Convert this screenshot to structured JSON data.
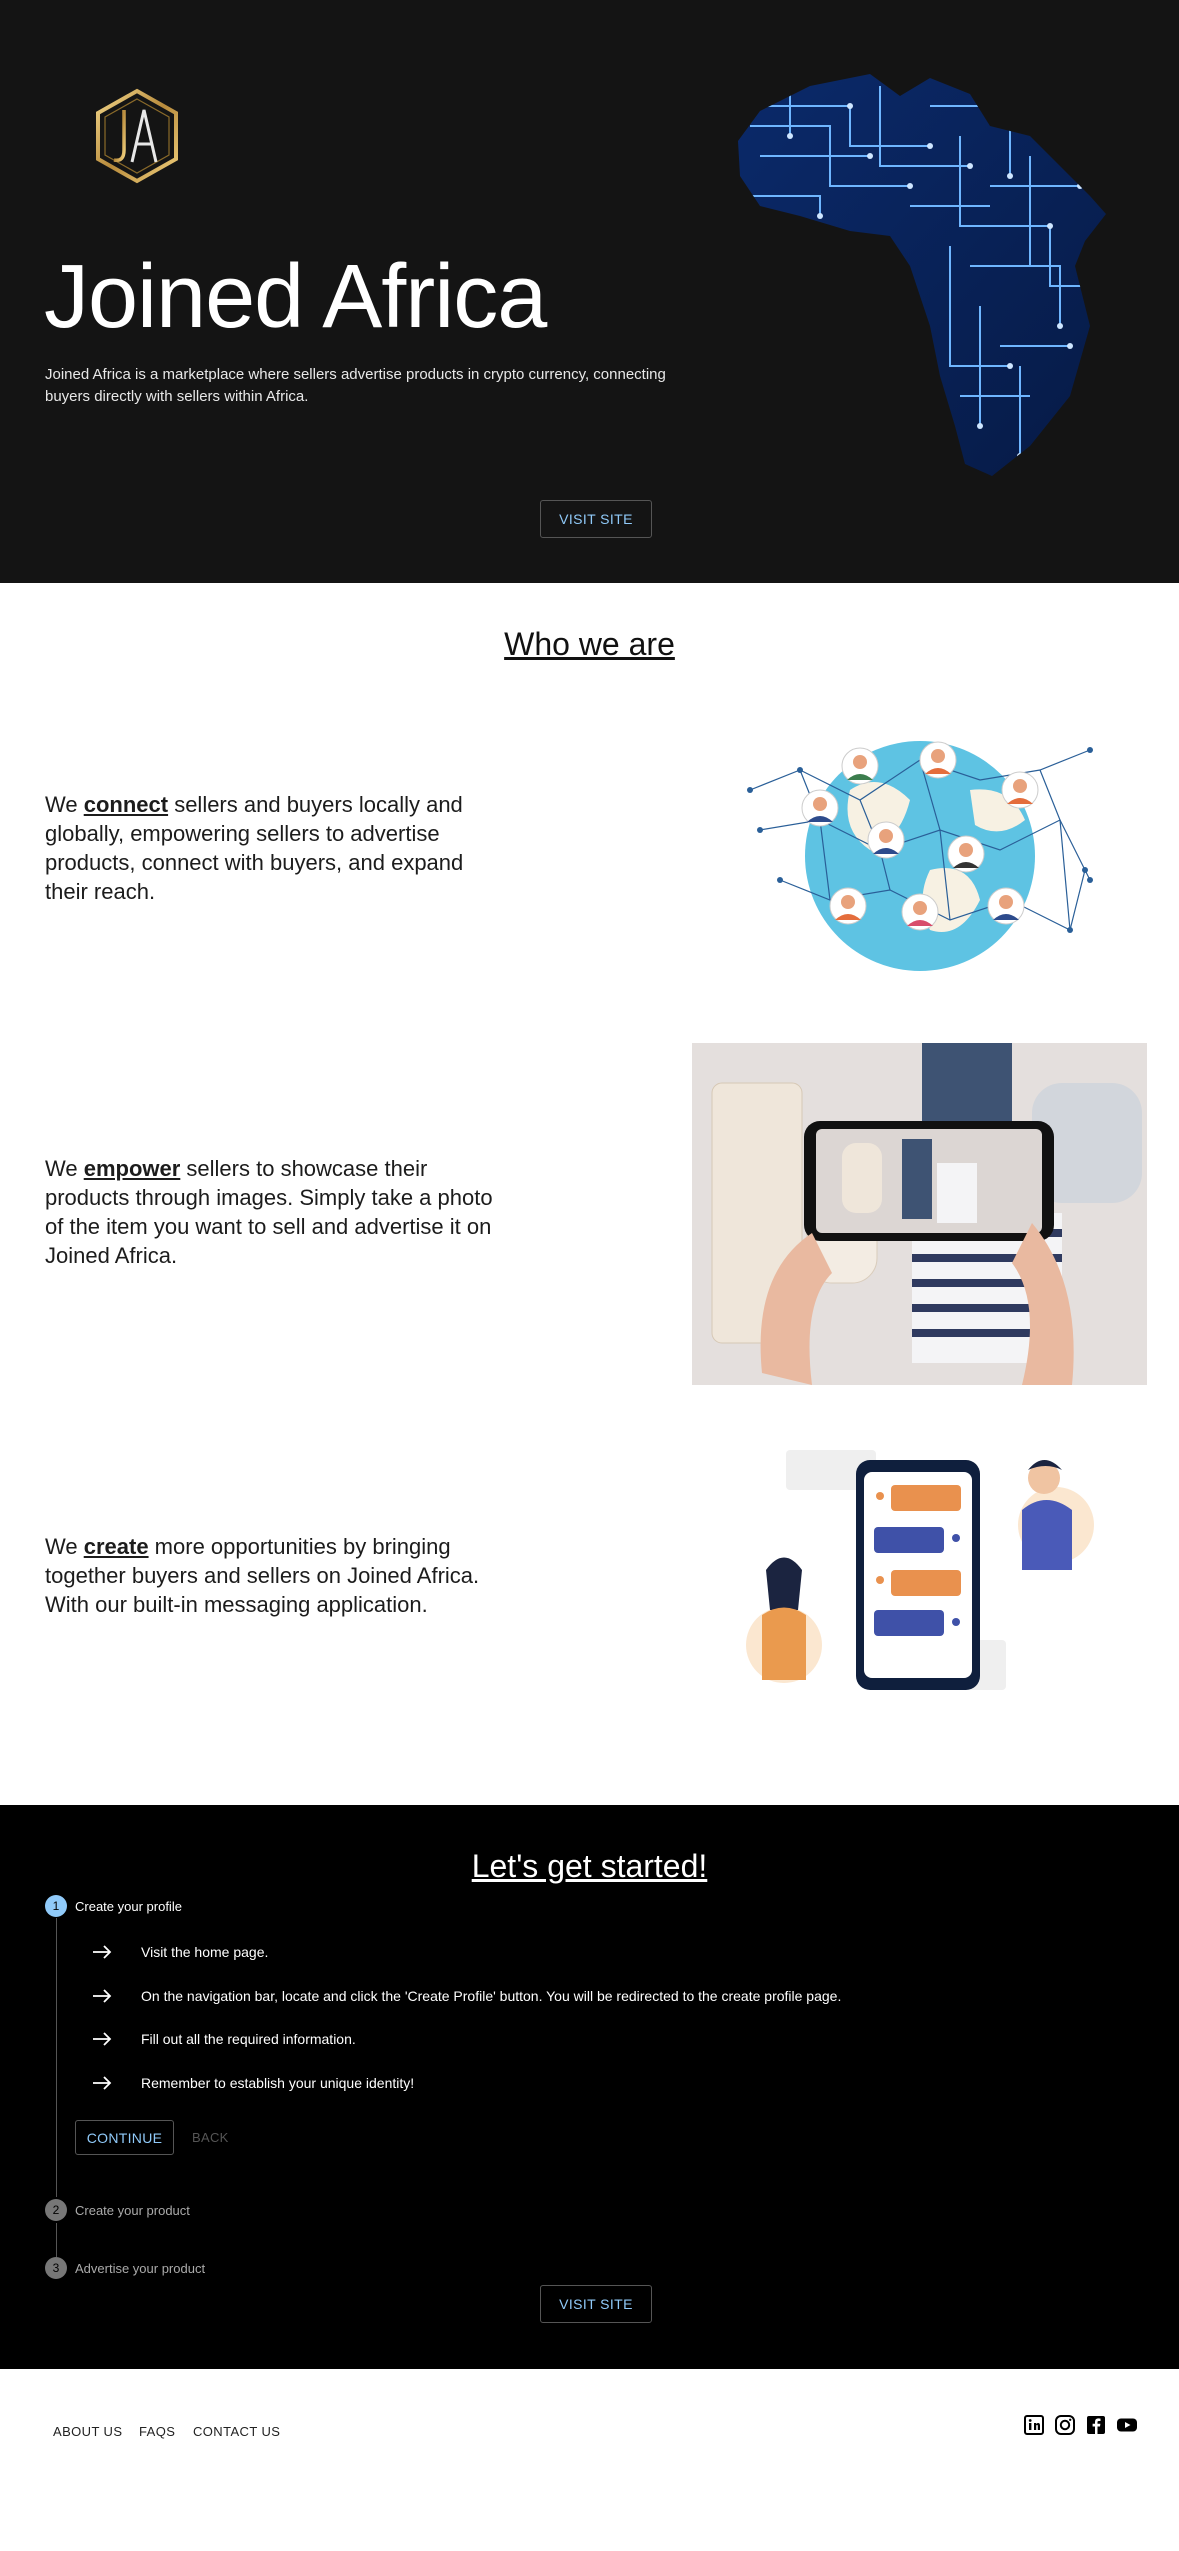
{
  "hero": {
    "title": "Joined Africa",
    "description": "Joined Africa is a marketplace where sellers advertise products in crypto currency, connecting buyers directly with sellers within Africa.",
    "visit_label": "VISIT SITE",
    "logo_letters": "JA"
  },
  "who": {
    "title": "Who we are",
    "features": [
      {
        "prefix": "We ",
        "keyword": "connect",
        "rest": " sellers and buyers locally and globally, empowering sellers to advertise products, connect with buyers, and expand their reach."
      },
      {
        "prefix": "We ",
        "keyword": "empower",
        "rest": " sellers to showcase their products through images. Simply take a photo of the item you want to sell and advertise it on Joined Africa."
      },
      {
        "prefix": "We ",
        "keyword": "create",
        "rest": " more opportunities by bringing together buyers and sellers on Joined Africa. With our built-in messaging application."
      }
    ]
  },
  "started": {
    "title": "Let's get started!",
    "steps": [
      {
        "number": "1",
        "label": "Create your profile"
      },
      {
        "number": "2",
        "label": "Create your product"
      },
      {
        "number": "3",
        "label": "Advertise your product"
      }
    ],
    "instructions": [
      "Visit the home page.",
      "On the navigation bar, locate and click the 'Create Profile' button. You will be redirected to the create profile page.",
      "Fill out all the required information.",
      "Remember to establish your unique identity!"
    ],
    "continue_label": "CONTINUE",
    "back_label": "BACK",
    "visit_label": "VISIT SITE"
  },
  "footer": {
    "links": [
      "ABOUT US",
      "FAQS",
      "CONTACT US"
    ],
    "social_icons": [
      "linkedin-icon",
      "instagram-icon",
      "facebook-icon",
      "youtube-icon"
    ]
  },
  "colors": {
    "hero_bg": "#141414",
    "accent": "#90caf9",
    "started_bg": "#000000"
  }
}
